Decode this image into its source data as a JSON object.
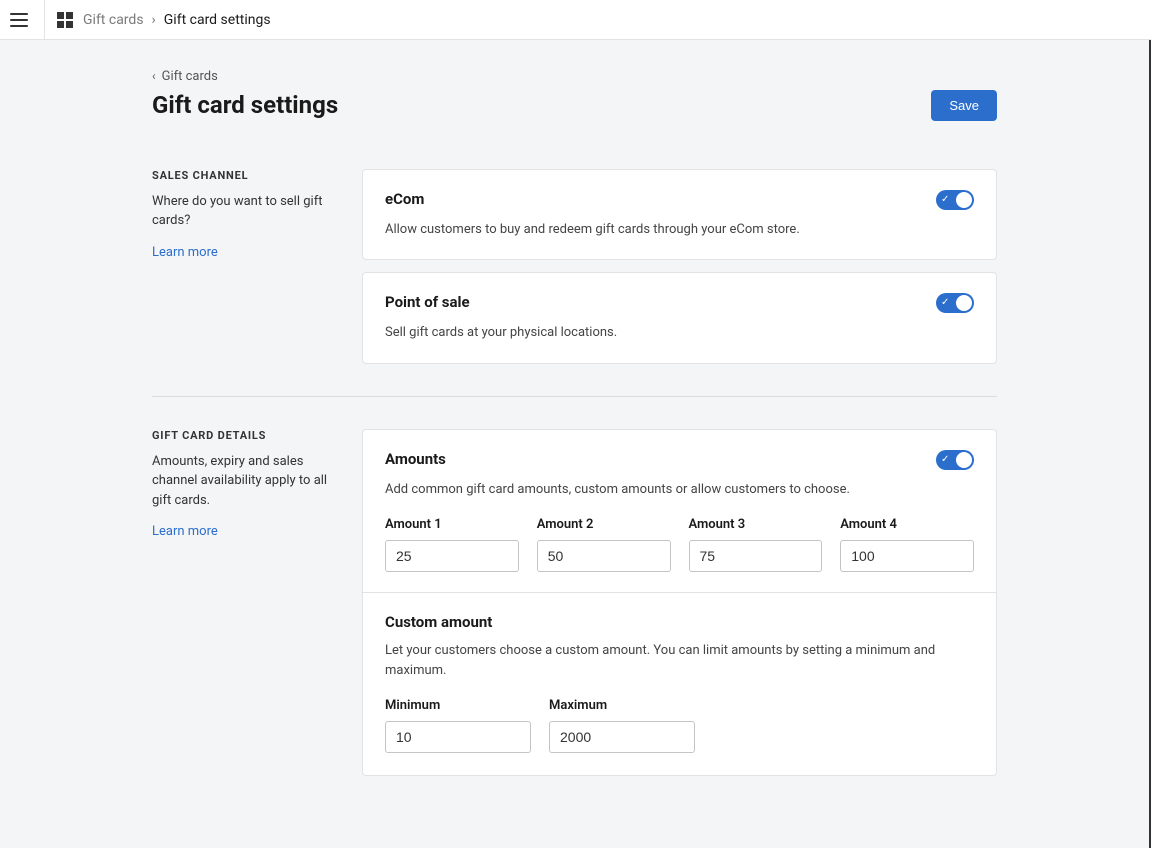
{
  "topbar": {
    "breadcrumb_parent": "Gift cards",
    "breadcrumb_separator": "›",
    "breadcrumb_current": "Gift card settings"
  },
  "page": {
    "back_label": "Gift cards",
    "title": "Gift card settings",
    "save_label": "Save"
  },
  "sections": {
    "sales_channel": {
      "title": "SALES CHANNEL",
      "desc": "Where do you want to sell gift cards?",
      "learn_more": "Learn more",
      "cards": {
        "ecom": {
          "title": "eCom",
          "desc": "Allow customers to buy and redeem gift cards through your eCom store.",
          "enabled": true
        },
        "pos": {
          "title": "Point of sale",
          "desc": "Sell gift cards at your physical locations.",
          "enabled": true
        }
      }
    },
    "details": {
      "title": "GIFT CARD DETAILS",
      "desc": "Amounts, expiry and sales channel availability apply to all gift cards.",
      "learn_more": "Learn more",
      "amounts": {
        "title": "Amounts",
        "desc": "Add common gift card amounts, custom amounts or allow customers to choose.",
        "enabled": true,
        "fields": [
          {
            "label": "Amount 1",
            "value": "25"
          },
          {
            "label": "Amount 2",
            "value": "50"
          },
          {
            "label": "Amount 3",
            "value": "75"
          },
          {
            "label": "Amount 4",
            "value": "100"
          }
        ]
      },
      "custom": {
        "title": "Custom amount",
        "desc": "Let your customers choose a custom amount. You can limit amounts by setting a minimum and maximum.",
        "min_label": "Minimum",
        "min_value": "10",
        "max_label": "Maximum",
        "max_value": "2000"
      }
    }
  }
}
